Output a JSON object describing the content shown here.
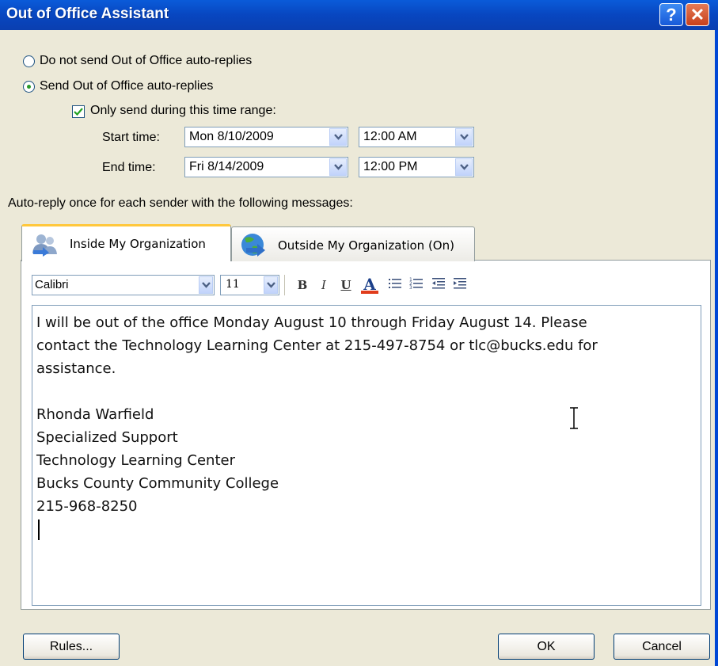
{
  "window": {
    "title": "Out of Office Assistant",
    "help_label": "?",
    "close_label": "✕"
  },
  "options": {
    "do_not_send": {
      "label": "Do not send Out of Office auto-replies",
      "selected": false
    },
    "send": {
      "label": "Send Out of Office auto-replies",
      "selected": true
    },
    "time_range": {
      "label": "Only send during this time range:",
      "checked": true
    }
  },
  "start_time": {
    "label": "Start time:",
    "date": "Mon 8/10/2009",
    "time": "12:00 AM"
  },
  "end_time": {
    "label": "End time:",
    "date": "Fri 8/14/2009",
    "time": "12:00 PM"
  },
  "autoreply_label": "Auto-reply once for each sender with the following messages:",
  "tabs": [
    {
      "label": "Inside My Organization",
      "icon": "people-icon",
      "active": true
    },
    {
      "label": "Outside My Organization (On)",
      "icon": "globe-icon",
      "active": false
    }
  ],
  "formatting": {
    "font": "Calibri",
    "size": "11",
    "bold": "B",
    "italic": "I",
    "underline": "U",
    "font_color": "A",
    "font_color_hex": "#e03c1c"
  },
  "message_lines": [
    "I will be out of the office Monday August 10 through Friday August 14.  Please",
    "contact the Technology Learning Center at 215-497-8754 or tlc@bucks.edu for",
    "assistance.",
    "",
    "Rhonda Warfield",
    "Specialized Support",
    "Technology Learning Center",
    "Bucks County Community College",
    "215-968-8250"
  ],
  "buttons": {
    "rules": "Rules...",
    "ok": "OK",
    "cancel": "Cancel"
  }
}
